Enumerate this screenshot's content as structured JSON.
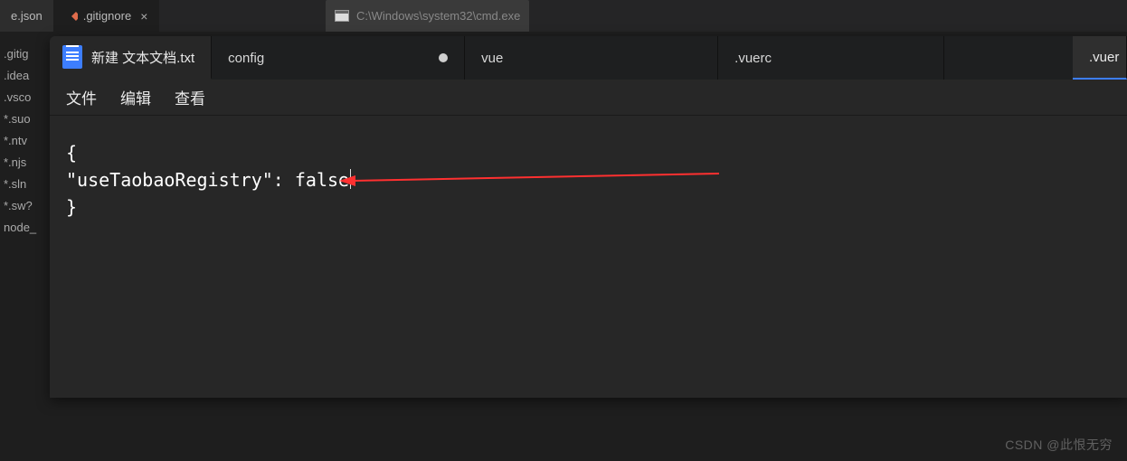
{
  "back": {
    "tabs": [
      {
        "label": "e.json"
      },
      {
        "label": ".gitignore",
        "active": true
      }
    ],
    "cmd_title": "C:\\Windows\\system32\\cmd.exe"
  },
  "sidebar": {
    "items": [
      ".gitig",
      ".idea",
      ".vsco",
      "*.suo",
      "*.ntv",
      "*.njs",
      "*.sln",
      "*.sw?",
      "node_"
    ]
  },
  "notepad": {
    "tabs": [
      {
        "label": "新建 文本文档.txt",
        "first": true
      },
      {
        "label": "config",
        "modified": true
      },
      {
        "label": "vue"
      },
      {
        "label": ".vuerc"
      },
      {
        "label": ".vuer",
        "last": true
      }
    ],
    "menu": {
      "file": "文件",
      "edit": "编辑",
      "view": "查看"
    },
    "content": {
      "line1": "{",
      "line2": "  \"useTaobaoRegistry\": false",
      "line3": "}"
    }
  },
  "watermark": "CSDN @此恨无穷"
}
